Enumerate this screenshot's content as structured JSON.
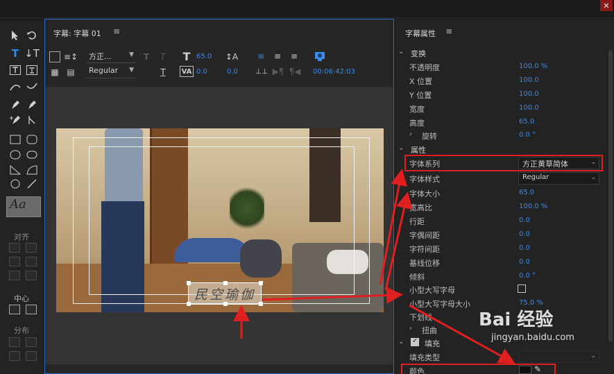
{
  "window": {
    "close_glyph": "✕"
  },
  "tools": {
    "align_label": "对齐",
    "center_label": "中心",
    "distribute_label": "分布",
    "style_swatch_text": "Aa"
  },
  "editor": {
    "tab_title": "字幕: 字幕 01",
    "menu_glyph": "≡",
    "font_family": "方正...",
    "font_style": "Regular",
    "font_size": "65.0",
    "kerning": "0.0",
    "leading": "0.0",
    "timecode": "00:06:42:03",
    "title_text": "民空瑜伽"
  },
  "props": {
    "title": "字幕属性",
    "menu_glyph": "≡",
    "transform": {
      "label": "变换",
      "opacity_label": "不透明度",
      "opacity": "100.0 %",
      "x_label": "X 位置",
      "x": "100.0",
      "y_label": "Y 位置",
      "y": "100.0",
      "width_label": "宽度",
      "width": "100.0",
      "height_label": "高度",
      "height": "65.0",
      "rotation_label": "旋转",
      "rotation": "0.0 °"
    },
    "attributes": {
      "label": "属性",
      "font_family_label": "字体系列",
      "font_family": "方正黄草简体",
      "font_style_label": "字体样式",
      "font_style": "Regular",
      "font_size_label": "字体大小",
      "font_size": "65.0",
      "aspect_label": "宽高比",
      "aspect": "100.0 %",
      "leading_label": "行距",
      "leading": "0.0",
      "kerning_label": "字偶间距",
      "kerning": "0.0",
      "tracking_label": "字符间距",
      "tracking": "0.0",
      "baseline_label": "基线位移",
      "baseline": "0.0",
      "slant_label": "倾斜",
      "slant": "0.0 °",
      "smallcaps_label": "小型大写字母",
      "smallcaps_size_label": "小型大写字母大小",
      "smallcaps_size": "75.0 %",
      "underline_label": "下划线",
      "distort_label": "扭曲"
    },
    "fill": {
      "label": "填充",
      "fill_type_label": "填充类型",
      "color_label": "颜色"
    }
  },
  "watermark": {
    "main": "Bai 经验",
    "sub": "jingyan.baidu.com"
  },
  "colors": {
    "accent": "#3b8be8",
    "highlight": "#e02020",
    "panel_border": "#2d6fd0"
  }
}
